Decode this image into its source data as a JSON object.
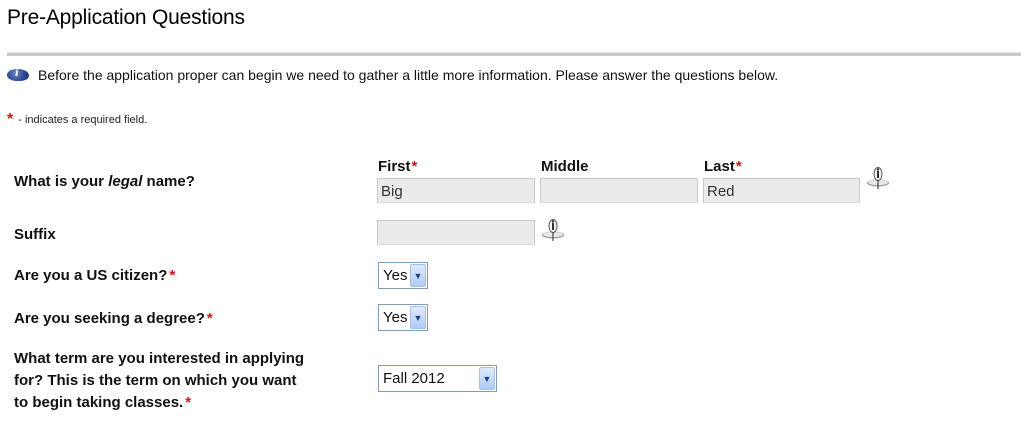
{
  "page": {
    "title": "Pre-Application Questions",
    "info_text": "Before the application proper can begin we need to gather a little more information. Please answer the questions below.",
    "required_legend": "- indicates a required field.",
    "required_marker": "*"
  },
  "name_question": {
    "label_before": "What is your ",
    "label_emphasis": "legal",
    "label_after": " name?",
    "first_label": "First",
    "middle_label": "Middle",
    "last_label": "Last",
    "first_value": "Big",
    "middle_value": "",
    "last_value": "Red"
  },
  "suffix_question": {
    "label": "Suffix",
    "value": ""
  },
  "citizen_question": {
    "label": "Are you a US citizen?",
    "selected": "Yes"
  },
  "degree_question": {
    "label": "Are you seeking a degree?",
    "selected": "Yes"
  },
  "term_question": {
    "line1": "What term are you interested in applying",
    "line2": "for? This is the term on which you want",
    "line3": "to begin taking classes.",
    "selected": "Fall 2012"
  },
  "icons": {
    "info": "info-icon",
    "help": "help-pin-icon",
    "dropdown": "chevron-down-icon"
  },
  "colors": {
    "required": "#dd1111",
    "input_bg": "#ebebeb",
    "select_border": "#7f9db9",
    "rule": "#c8c8c8"
  }
}
